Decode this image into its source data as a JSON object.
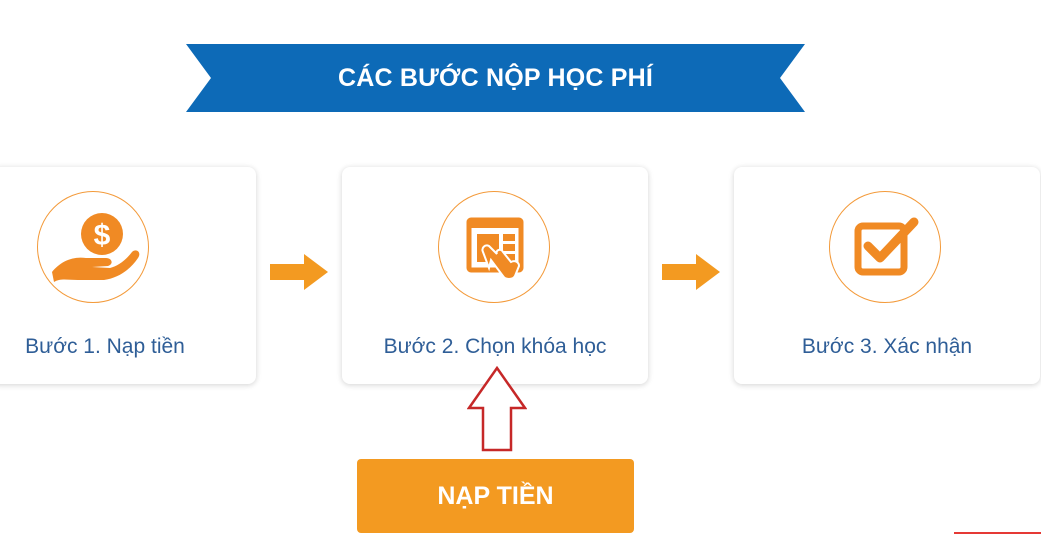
{
  "banner": {
    "title": "CÁC BƯỚC NỘP HỌC PHÍ",
    "color": "#0d6ab7"
  },
  "steps": [
    {
      "label": "Bước 1. Nạp tiền",
      "icon": "money-hand-icon"
    },
    {
      "label": "Bước 2. Chọn khóa học",
      "icon": "select-course-icon"
    },
    {
      "label": "Bước 3. Xác nhận",
      "icon": "checkbox-confirm-icon"
    }
  ],
  "action": {
    "button_label": "NẠP TIỀN",
    "button_color": "#f39a21"
  },
  "colors": {
    "accent_orange": "#f39a21",
    "label_blue": "#2f5e97",
    "pointer_red": "#c62828"
  }
}
